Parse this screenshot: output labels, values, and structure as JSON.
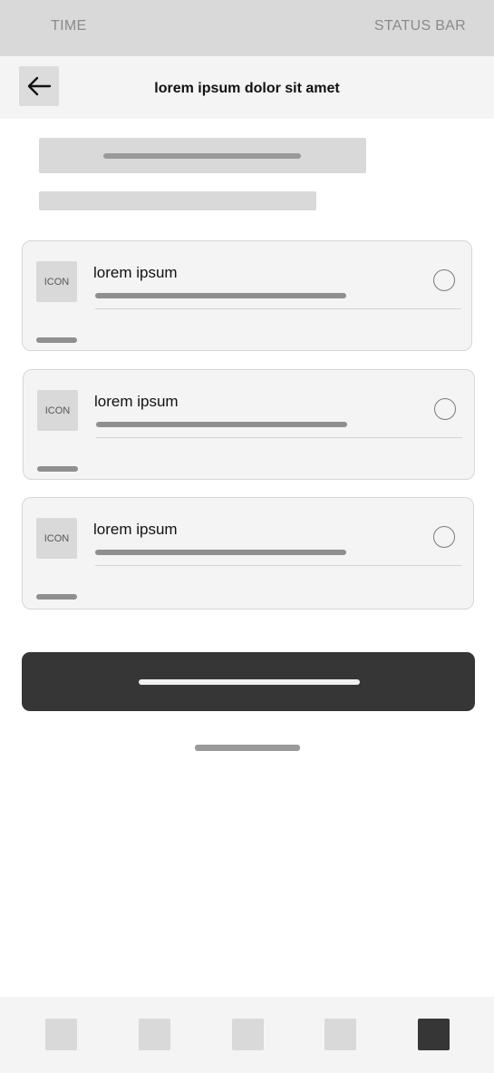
{
  "status_bar": {
    "time": "TIME",
    "right_label": "STATUS BAR"
  },
  "header": {
    "back_icon": "arrow-left-icon",
    "title": "lorem ipsum dolor sit amet"
  },
  "options": [
    {
      "icon_text": "ICON",
      "label": "lorem ipsum",
      "selected": false
    },
    {
      "icon_text": "ICON",
      "label": "lorem ipsum",
      "selected": false
    },
    {
      "icon_text": "ICON",
      "label": "lorem ipsum",
      "selected": false
    }
  ],
  "bottom_nav": {
    "active_index": 4,
    "item_count": 5
  },
  "colors": {
    "accent_dark": "#363636",
    "placeholder": "#d9d9d9",
    "surface": "#f4f4f4"
  }
}
